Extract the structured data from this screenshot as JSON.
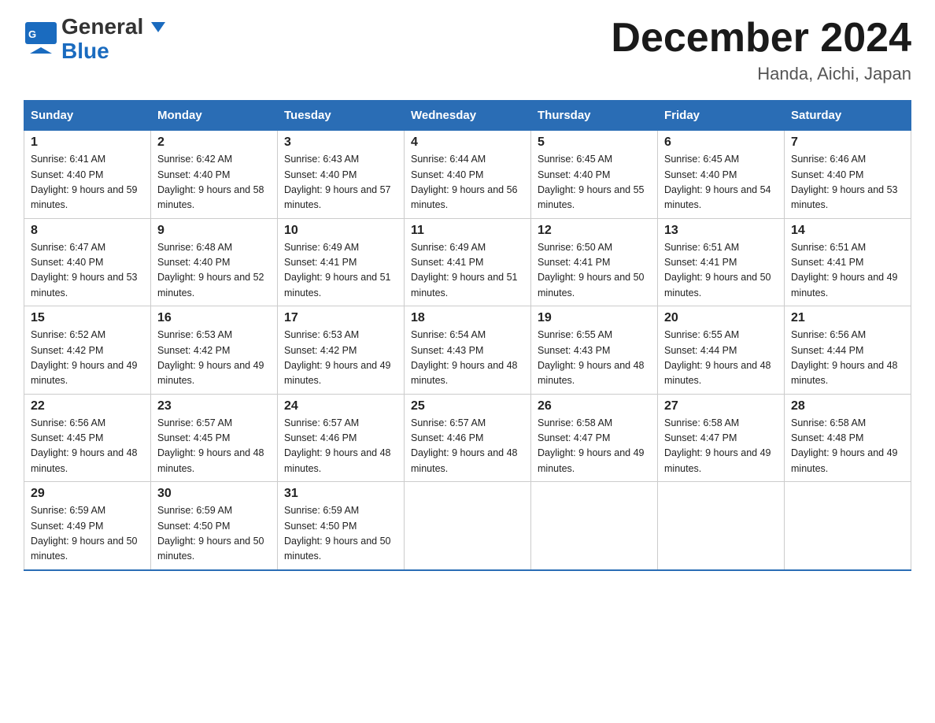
{
  "header": {
    "logo_line1": "General",
    "logo_line2": "Blue",
    "title": "December 2024",
    "subtitle": "Handa, Aichi, Japan"
  },
  "days_of_week": [
    "Sunday",
    "Monday",
    "Tuesday",
    "Wednesday",
    "Thursday",
    "Friday",
    "Saturday"
  ],
  "weeks": [
    [
      {
        "date": "1",
        "sunrise": "6:41 AM",
        "sunset": "4:40 PM",
        "daylight": "9 hours and 59 minutes."
      },
      {
        "date": "2",
        "sunrise": "6:42 AM",
        "sunset": "4:40 PM",
        "daylight": "9 hours and 58 minutes."
      },
      {
        "date": "3",
        "sunrise": "6:43 AM",
        "sunset": "4:40 PM",
        "daylight": "9 hours and 57 minutes."
      },
      {
        "date": "4",
        "sunrise": "6:44 AM",
        "sunset": "4:40 PM",
        "daylight": "9 hours and 56 minutes."
      },
      {
        "date": "5",
        "sunrise": "6:45 AM",
        "sunset": "4:40 PM",
        "daylight": "9 hours and 55 minutes."
      },
      {
        "date": "6",
        "sunrise": "6:45 AM",
        "sunset": "4:40 PM",
        "daylight": "9 hours and 54 minutes."
      },
      {
        "date": "7",
        "sunrise": "6:46 AM",
        "sunset": "4:40 PM",
        "daylight": "9 hours and 53 minutes."
      }
    ],
    [
      {
        "date": "8",
        "sunrise": "6:47 AM",
        "sunset": "4:40 PM",
        "daylight": "9 hours and 53 minutes."
      },
      {
        "date": "9",
        "sunrise": "6:48 AM",
        "sunset": "4:40 PM",
        "daylight": "9 hours and 52 minutes."
      },
      {
        "date": "10",
        "sunrise": "6:49 AM",
        "sunset": "4:41 PM",
        "daylight": "9 hours and 51 minutes."
      },
      {
        "date": "11",
        "sunrise": "6:49 AM",
        "sunset": "4:41 PM",
        "daylight": "9 hours and 51 minutes."
      },
      {
        "date": "12",
        "sunrise": "6:50 AM",
        "sunset": "4:41 PM",
        "daylight": "9 hours and 50 minutes."
      },
      {
        "date": "13",
        "sunrise": "6:51 AM",
        "sunset": "4:41 PM",
        "daylight": "9 hours and 50 minutes."
      },
      {
        "date": "14",
        "sunrise": "6:51 AM",
        "sunset": "4:41 PM",
        "daylight": "9 hours and 49 minutes."
      }
    ],
    [
      {
        "date": "15",
        "sunrise": "6:52 AM",
        "sunset": "4:42 PM",
        "daylight": "9 hours and 49 minutes."
      },
      {
        "date": "16",
        "sunrise": "6:53 AM",
        "sunset": "4:42 PM",
        "daylight": "9 hours and 49 minutes."
      },
      {
        "date": "17",
        "sunrise": "6:53 AM",
        "sunset": "4:42 PM",
        "daylight": "9 hours and 49 minutes."
      },
      {
        "date": "18",
        "sunrise": "6:54 AM",
        "sunset": "4:43 PM",
        "daylight": "9 hours and 48 minutes."
      },
      {
        "date": "19",
        "sunrise": "6:55 AM",
        "sunset": "4:43 PM",
        "daylight": "9 hours and 48 minutes."
      },
      {
        "date": "20",
        "sunrise": "6:55 AM",
        "sunset": "4:44 PM",
        "daylight": "9 hours and 48 minutes."
      },
      {
        "date": "21",
        "sunrise": "6:56 AM",
        "sunset": "4:44 PM",
        "daylight": "9 hours and 48 minutes."
      }
    ],
    [
      {
        "date": "22",
        "sunrise": "6:56 AM",
        "sunset": "4:45 PM",
        "daylight": "9 hours and 48 minutes."
      },
      {
        "date": "23",
        "sunrise": "6:57 AM",
        "sunset": "4:45 PM",
        "daylight": "9 hours and 48 minutes."
      },
      {
        "date": "24",
        "sunrise": "6:57 AM",
        "sunset": "4:46 PM",
        "daylight": "9 hours and 48 minutes."
      },
      {
        "date": "25",
        "sunrise": "6:57 AM",
        "sunset": "4:46 PM",
        "daylight": "9 hours and 48 minutes."
      },
      {
        "date": "26",
        "sunrise": "6:58 AM",
        "sunset": "4:47 PM",
        "daylight": "9 hours and 49 minutes."
      },
      {
        "date": "27",
        "sunrise": "6:58 AM",
        "sunset": "4:47 PM",
        "daylight": "9 hours and 49 minutes."
      },
      {
        "date": "28",
        "sunrise": "6:58 AM",
        "sunset": "4:48 PM",
        "daylight": "9 hours and 49 minutes."
      }
    ],
    [
      {
        "date": "29",
        "sunrise": "6:59 AM",
        "sunset": "4:49 PM",
        "daylight": "9 hours and 50 minutes."
      },
      {
        "date": "30",
        "sunrise": "6:59 AM",
        "sunset": "4:50 PM",
        "daylight": "9 hours and 50 minutes."
      },
      {
        "date": "31",
        "sunrise": "6:59 AM",
        "sunset": "4:50 PM",
        "daylight": "9 hours and 50 minutes."
      },
      null,
      null,
      null,
      null
    ]
  ]
}
